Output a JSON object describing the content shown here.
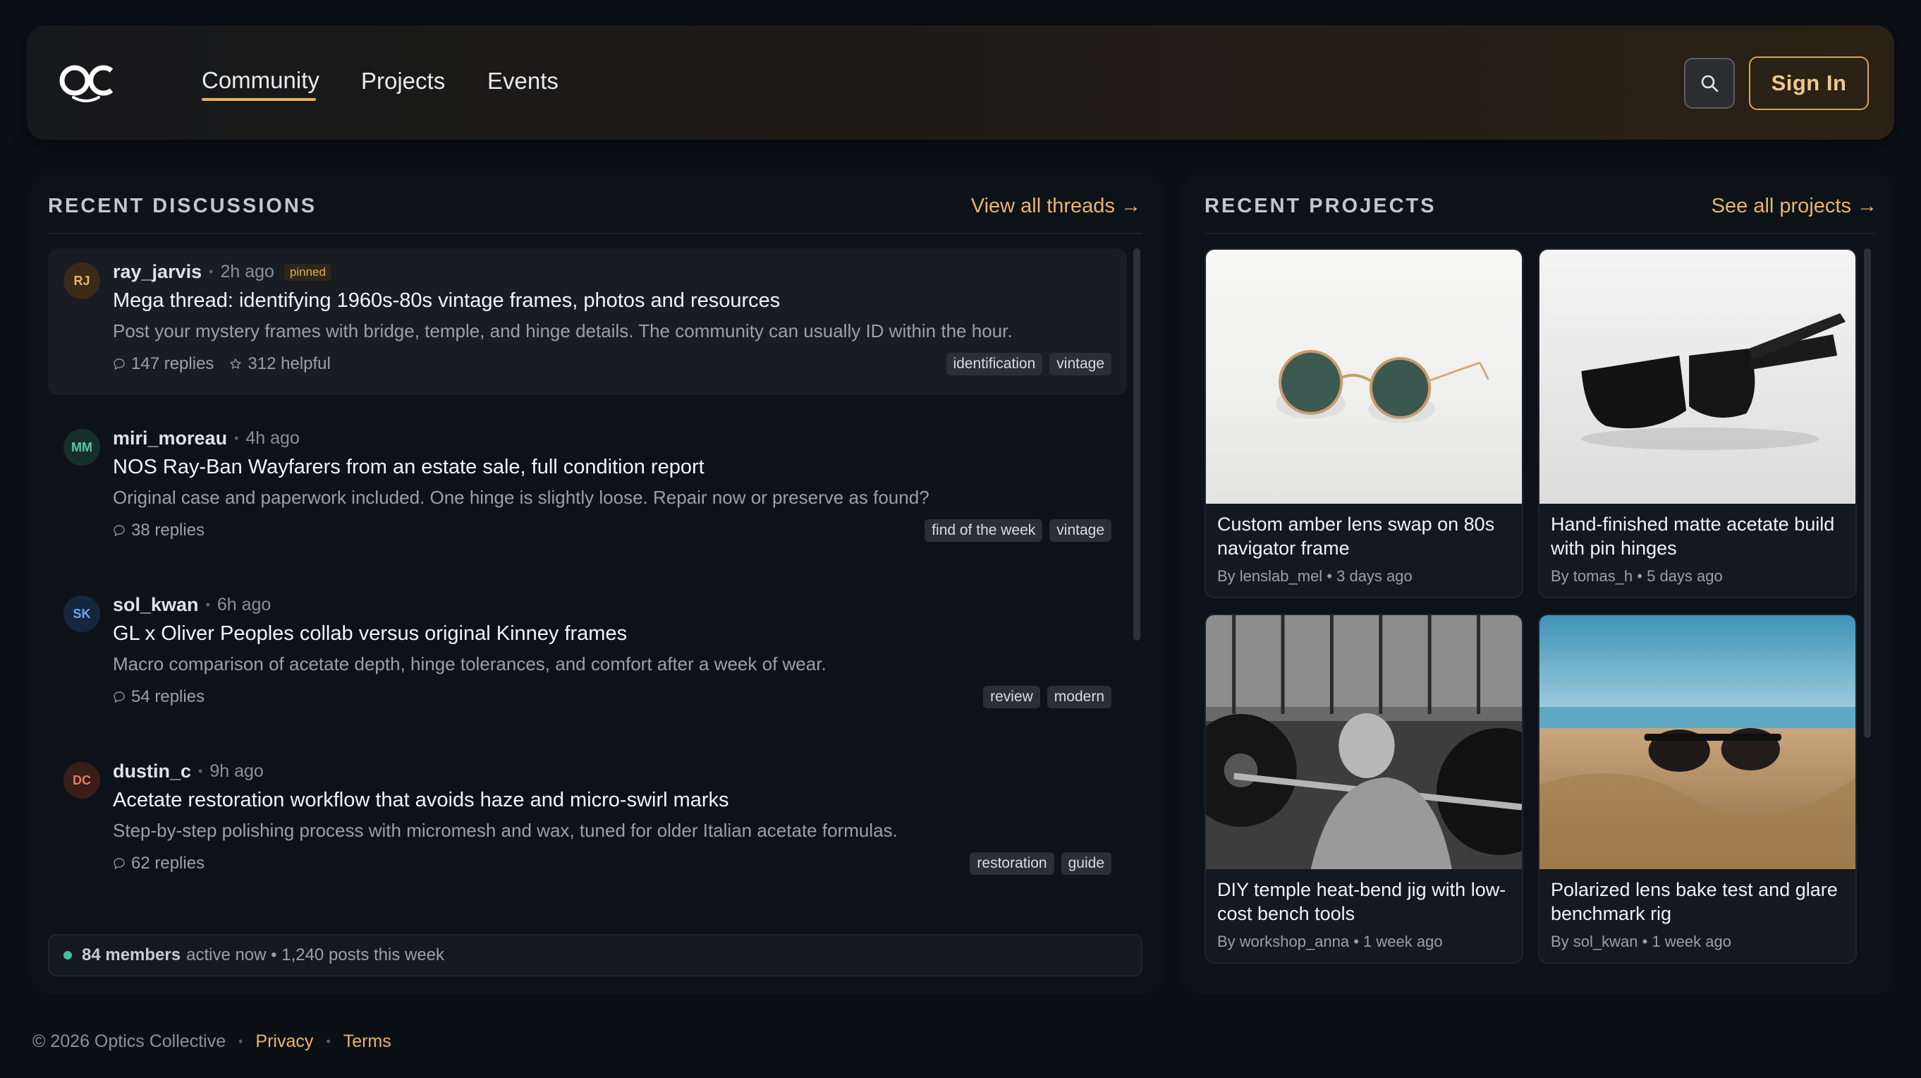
{
  "header": {
    "nav": [
      {
        "label": "Community",
        "active": true
      },
      {
        "label": "Projects",
        "active": false
      },
      {
        "label": "Events",
        "active": false
      }
    ],
    "search_icon": "search-icon",
    "signin_label": "Sign In"
  },
  "discussions": {
    "title": "RECENT DISCUSSIONS",
    "view_all": "View all threads →",
    "threads": [
      {
        "initials": "RJ",
        "username": "ray_jarvis",
        "time": "2h ago",
        "badge": "pinned",
        "title": "Mega thread: identifying 1960s-80s vintage frames, photos and resources",
        "snippet": "Post your mystery frames with bridge, temple, and hinge details. The community can usually ID within the hour.",
        "replies": "147 replies",
        "helpful": "312 helpful",
        "tags": [
          "identification",
          "vintage"
        ]
      },
      {
        "initials": "MM",
        "username": "miri_moreau",
        "time": "4h ago",
        "title": "NOS Ray-Ban Wayfarers from an estate sale, full condition report",
        "snippet": "Original case and paperwork included. One hinge is slightly loose. Repair now or preserve as found?",
        "replies": "38 replies",
        "tags": [
          "find of the week",
          "vintage"
        ]
      },
      {
        "initials": "SK",
        "username": "sol_kwan",
        "time": "6h ago",
        "title": "GL x Oliver Peoples collab versus original Kinney frames",
        "snippet": "Macro comparison of acetate depth, hinge tolerances, and comfort after a week of wear.",
        "replies": "54 replies",
        "tags": [
          "review",
          "modern"
        ]
      },
      {
        "initials": "DC",
        "username": "dustin_c",
        "time": "9h ago",
        "title": "Acetate restoration workflow that avoids haze and micro-swirl marks",
        "snippet": "Step-by-step polishing process with micromesh and wax, tuned for older Italian acetate formulas.",
        "replies": "62 replies",
        "tags": [
          "restoration",
          "guide"
        ]
      }
    ],
    "activity": {
      "members": "84 members",
      "rest": "active now • 1,240 posts this week"
    }
  },
  "projects": {
    "title": "RECENT PROJECTS",
    "see_all": "See all projects →",
    "cards": [
      {
        "title": "Custom amber lens swap on 80s navigator frame",
        "meta": "By lenslab_mel • 3 days ago"
      },
      {
        "title": "Hand-finished matte acetate build with pin hinges",
        "meta": "By tomas_h • 5 days ago"
      },
      {
        "title": "DIY temple heat-bend jig with low-cost bench tools",
        "meta": "By workshop_anna • 1 week ago"
      },
      {
        "title": "Polarized lens bake test and glare benchmark rig",
        "meta": "By sol_kwan • 1 week ago"
      }
    ]
  },
  "footer": {
    "copyright": "© 2026 Optics Collective",
    "privacy": "Privacy",
    "terms": "Terms"
  },
  "colors": {
    "accent": "#eab467",
    "background": "#0b0f16",
    "online": "#46c19a"
  }
}
